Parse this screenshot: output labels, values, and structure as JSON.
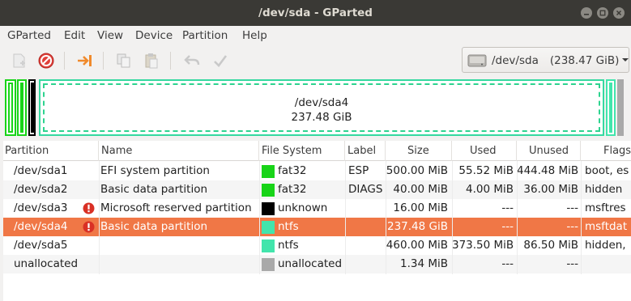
{
  "window": {
    "title": "/dev/sda - GParted"
  },
  "menu": [
    "GParted",
    "Edit",
    "View",
    "Device",
    "Partition",
    "Help"
  ],
  "toolbar": {
    "icons": [
      "new-partition-icon",
      "delete-icon",
      "resize-move-icon",
      "copy-icon",
      "paste-icon",
      "undo-icon",
      "apply-icon"
    ]
  },
  "device_selector": {
    "device": "/dev/sda",
    "size": "(238.47 GiB)"
  },
  "graphic": {
    "main_partition": "/dev/sda4",
    "main_size": "237.48 GiB"
  },
  "table": {
    "headers": [
      "Partition",
      "Name",
      "File System",
      "Label",
      "Size",
      "Used",
      "Unused",
      "Flags"
    ],
    "rows": [
      {
        "partition": "/dev/sda1",
        "name": "EFI system partition",
        "fs": "fat32",
        "fs_color": "#18d418",
        "label": "ESP",
        "size": "500.00 MiB",
        "used": "55.52 MiB",
        "unused": "444.48 MiB",
        "flags": "boot, es",
        "warning": false
      },
      {
        "partition": "/dev/sda2",
        "name": "Basic data partition",
        "fs": "fat32",
        "fs_color": "#18d418",
        "label": "DIAGS",
        "size": "40.00 MiB",
        "used": "4.00 MiB",
        "unused": "36.00 MiB",
        "flags": "hidden",
        "warning": false
      },
      {
        "partition": "/dev/sda3",
        "name": "Microsoft reserved partition",
        "fs": "unknown",
        "fs_color": "#000000",
        "label": "",
        "size": "16.00 MiB",
        "used": "---",
        "unused": "---",
        "flags": "msftres",
        "warning": true
      },
      {
        "partition": "/dev/sda4",
        "name": "Basic data partition",
        "fs": "ntfs",
        "fs_color": "#42e5ac",
        "label": "",
        "size": "237.48 GiB",
        "used": "---",
        "unused": "---",
        "flags": "msftdat",
        "warning": true,
        "selected": true
      },
      {
        "partition": "/dev/sda5",
        "name": "",
        "fs": "ntfs",
        "fs_color": "#42e5ac",
        "label": "",
        "size": "460.00 MiB",
        "used": "373.50 MiB",
        "unused": "86.50 MiB",
        "flags": "hidden,",
        "warning": false
      },
      {
        "partition": "unallocated",
        "name": "",
        "fs": "unallocated",
        "fs_color": "#a9a9a9",
        "label": "",
        "size": "1.34 MiB",
        "used": "---",
        "unused": "---",
        "flags": "",
        "warning": false
      }
    ]
  },
  "colors": {
    "selection": "#f07746",
    "titlebar": "#3a3935",
    "ntfs": "#42e5ac",
    "fat32": "#18d418"
  }
}
